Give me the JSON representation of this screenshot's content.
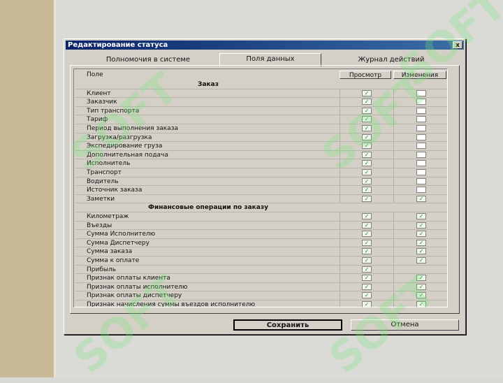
{
  "window": {
    "title": "Редактирование статуса",
    "close_label": "x"
  },
  "tabs": [
    {
      "label": "Полномочия в системе",
      "active": false
    },
    {
      "label": "Поля данных",
      "active": true
    },
    {
      "label": "Журнал действий",
      "active": false
    }
  ],
  "grid": {
    "headers": {
      "field": "Поле",
      "view": "Просмотр",
      "edit": "Изменения"
    },
    "rows": [
      {
        "section": "Заказ"
      },
      {
        "label": "Клиент",
        "view": true,
        "edit": false
      },
      {
        "label": "Заказчик",
        "view": true,
        "edit": false
      },
      {
        "label": "Тип транспорта",
        "view": true,
        "edit": false
      },
      {
        "label": "Тариф",
        "view": true,
        "edit": false
      },
      {
        "label": "Период выполнения заказа",
        "view": true,
        "edit": false
      },
      {
        "label": "Загрузка/разгрузка",
        "view": true,
        "edit": false
      },
      {
        "label": "Экспедирование груза",
        "view": true,
        "edit": false
      },
      {
        "label": "Дополнительная подача",
        "view": true,
        "edit": false
      },
      {
        "label": "Исполнитель",
        "view": true,
        "edit": false
      },
      {
        "label": "Транспорт",
        "view": true,
        "edit": false
      },
      {
        "label": "Водитель",
        "view": true,
        "edit": false
      },
      {
        "label": "Источник заказа",
        "view": true,
        "edit": false
      },
      {
        "label": "Заметки",
        "view": true,
        "edit": true
      },
      {
        "section": "Финансовые операции по заказу"
      },
      {
        "label": "Километраж",
        "view": true,
        "edit": true
      },
      {
        "label": "Въезды",
        "view": true,
        "edit": true
      },
      {
        "label": "Сумма Исполнителю",
        "view": true,
        "edit": true
      },
      {
        "label": "Сумма Диспетчеру",
        "view": true,
        "edit": true
      },
      {
        "label": "Сумма заказа",
        "view": true,
        "edit": true
      },
      {
        "label": "Сумма к оплате",
        "view": true,
        "edit": true
      },
      {
        "label": "Прибыль",
        "view": true,
        "edit": null
      },
      {
        "label": "Признак оплаты клиента",
        "view": true,
        "edit": true
      },
      {
        "label": "Признак оплаты исполнителю",
        "view": true,
        "edit": true
      },
      {
        "label": "Признак оплаты диспетчеру",
        "view": true,
        "edit": true
      },
      {
        "label": "Признак начисления суммы въездов исполнителю",
        "view": true,
        "edit": true
      }
    ]
  },
  "buttons": {
    "save": "Сохранить",
    "cancel": "Отмена"
  },
  "watermark": "SOFT"
}
